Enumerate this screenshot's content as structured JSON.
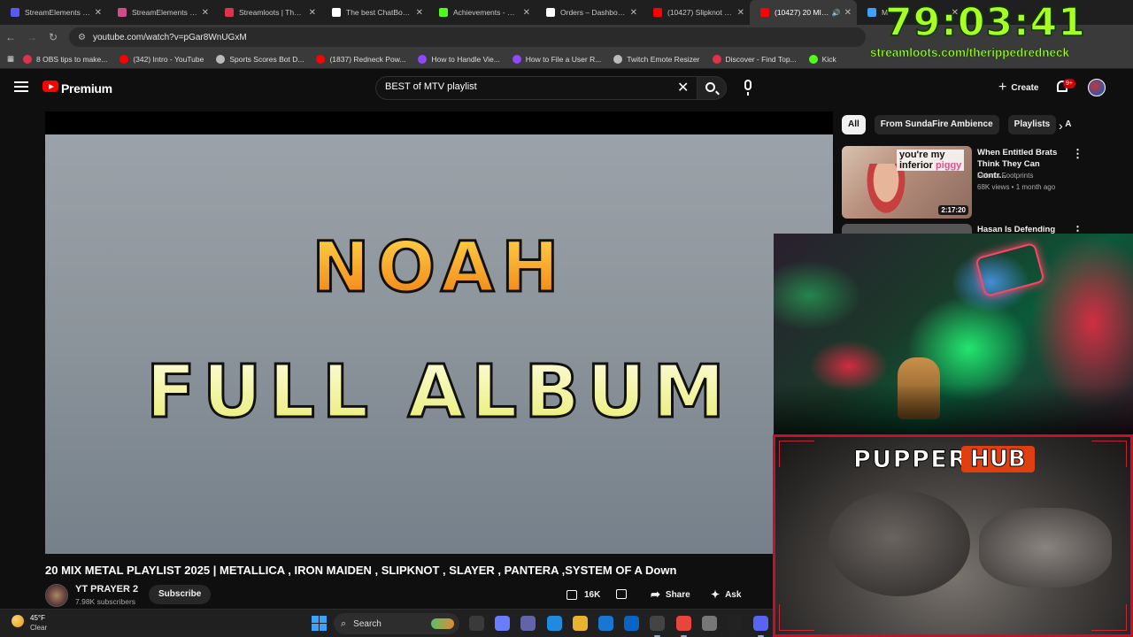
{
  "browser": {
    "tabs": [
      {
        "title": "StreamElements - Ov",
        "color": "#5a5af0",
        "icon": "streamelements-icon",
        "active": false,
        "audio": false
      },
      {
        "title": "StreamElements - rip",
        "color": "#d14d8a",
        "icon": "streamelements-icon",
        "active": false,
        "audio": false
      },
      {
        "title": "Streamloots | Therip",
        "color": "#e0324b",
        "icon": "streamloots-icon",
        "active": false,
        "audio": false
      },
      {
        "title": "The best ChatBot and",
        "color": "#ffffff",
        "icon": "chatbot-icon",
        "active": false,
        "audio": false
      },
      {
        "title": "Achievements - Kick",
        "color": "#53fc18",
        "icon": "kick-icon",
        "active": false,
        "audio": false
      },
      {
        "title": "Orders – Dashboard",
        "color": "#ffffff",
        "icon": "dashboard-icon",
        "active": false,
        "audio": false
      },
      {
        "title": "(10427) Slipknot - Du",
        "color": "#ff0000",
        "icon": "youtube-icon",
        "active": false,
        "audio": false
      },
      {
        "title": "(10427) 20 MIX ME",
        "color": "#ff0000",
        "icon": "youtube-icon",
        "active": true,
        "audio": true
      },
      {
        "title": "M",
        "color": "#3ea0ff",
        "icon": "chrome-icon",
        "active": false,
        "audio": false
      }
    ],
    "url": "youtube.com/watch?v=pGar8WnUGxM",
    "bookmarks": [
      {
        "label": "8 OBS tips to make...",
        "color": "#e0324b",
        "icon": "obs-icon"
      },
      {
        "label": "(342) Intro - YouTube",
        "color": "#ff0000",
        "icon": "youtube-icon"
      },
      {
        "label": "Sports Scores Bot D...",
        "color": "#bbbbbb",
        "icon": "globe-icon"
      },
      {
        "label": "(1837) Redneck Pow...",
        "color": "#ff0000",
        "icon": "youtube-icon"
      },
      {
        "label": "How to Handle Vie...",
        "color": "#9146ff",
        "icon": "twitch-icon"
      },
      {
        "label": "How to File a User R...",
        "color": "#9146ff",
        "icon": "twitch-icon"
      },
      {
        "label": "Twitch Emote Resizer",
        "color": "#bbbbbb",
        "icon": "globe-icon"
      },
      {
        "label": "Discover - Find Top...",
        "color": "#e0324b",
        "icon": "streamloots-icon"
      },
      {
        "label": "Kick",
        "color": "#53fc18",
        "icon": "kick-icon"
      }
    ]
  },
  "youtube": {
    "logo_text": "Premium",
    "search_value": "BEST of MTV playlist",
    "create_label": "Create",
    "notification_count": "9+",
    "video": {
      "thumbnail_line1": "NOAH",
      "thumbnail_line2": "FULL ALBUM",
      "title": "20 MIX METAL PLAYLIST 2025 | METALLICA , IRON MAIDEN , SLIPKNOT , SLAYER , PANTERA ,SYSTEM OF A Down",
      "channel_name": "YT PRAYER 2",
      "subscribers": "7.98K subscribers",
      "subscribe_label": "Subscribe",
      "likes": "16K",
      "share_label": "Share",
      "ask_label": "Ask"
    },
    "chips": [
      {
        "label": "All",
        "active": true
      },
      {
        "label": "From SundaFire Ambience",
        "active": false
      },
      {
        "label": "Playlists",
        "active": false
      },
      {
        "label": "A",
        "active": false
      }
    ],
    "recommendations": [
      {
        "title": "When Entitled Brats Think They Can Contr...",
        "channel": "Felon's Footprints",
        "meta": "68K views • 1 month ago",
        "duration": "2:17:20",
        "thumb_text_1": "you're my",
        "thumb_text_2": "inferior",
        "thumb_text_3": "piggy"
      },
      {
        "title": "Hasan Is Defending"
      }
    ]
  },
  "overlay": {
    "timer": "79:03:41",
    "url": "streamloots.com/therippedredneck",
    "webcam_label": "PUPPER",
    "webcam_badge": "HUB",
    "accent": "#aaff22",
    "frame_color": "#c4102a"
  },
  "taskbar": {
    "weather_temp": "45°F",
    "weather_desc": "Clear",
    "search_label": "Search",
    "apps": [
      {
        "name": "file-explorer-icon",
        "color": "#3a3a3a",
        "open": false
      },
      {
        "name": "copilot-icon",
        "color": "#6a7cff",
        "open": false
      },
      {
        "name": "teams-icon",
        "color": "#6264a7",
        "open": false
      },
      {
        "name": "edge-icon",
        "color": "#1e8be0",
        "open": false
      },
      {
        "name": "folder-icon",
        "color": "#e8b430",
        "open": false
      },
      {
        "name": "store-icon",
        "color": "#1976d2",
        "open": false
      },
      {
        "name": "outlook-icon",
        "color": "#0a64c8",
        "open": false
      },
      {
        "name": "obs-icon",
        "color": "#444444",
        "open": true
      },
      {
        "name": "chrome-icon",
        "color": "#e8453c",
        "open": true
      },
      {
        "name": "game-controller-icon",
        "color": "#777777",
        "open": false
      },
      {
        "name": "terminal-icon",
        "color": "#222222",
        "open": false
      },
      {
        "name": "discord-icon",
        "color": "#5865f2",
        "open": true
      }
    ]
  }
}
